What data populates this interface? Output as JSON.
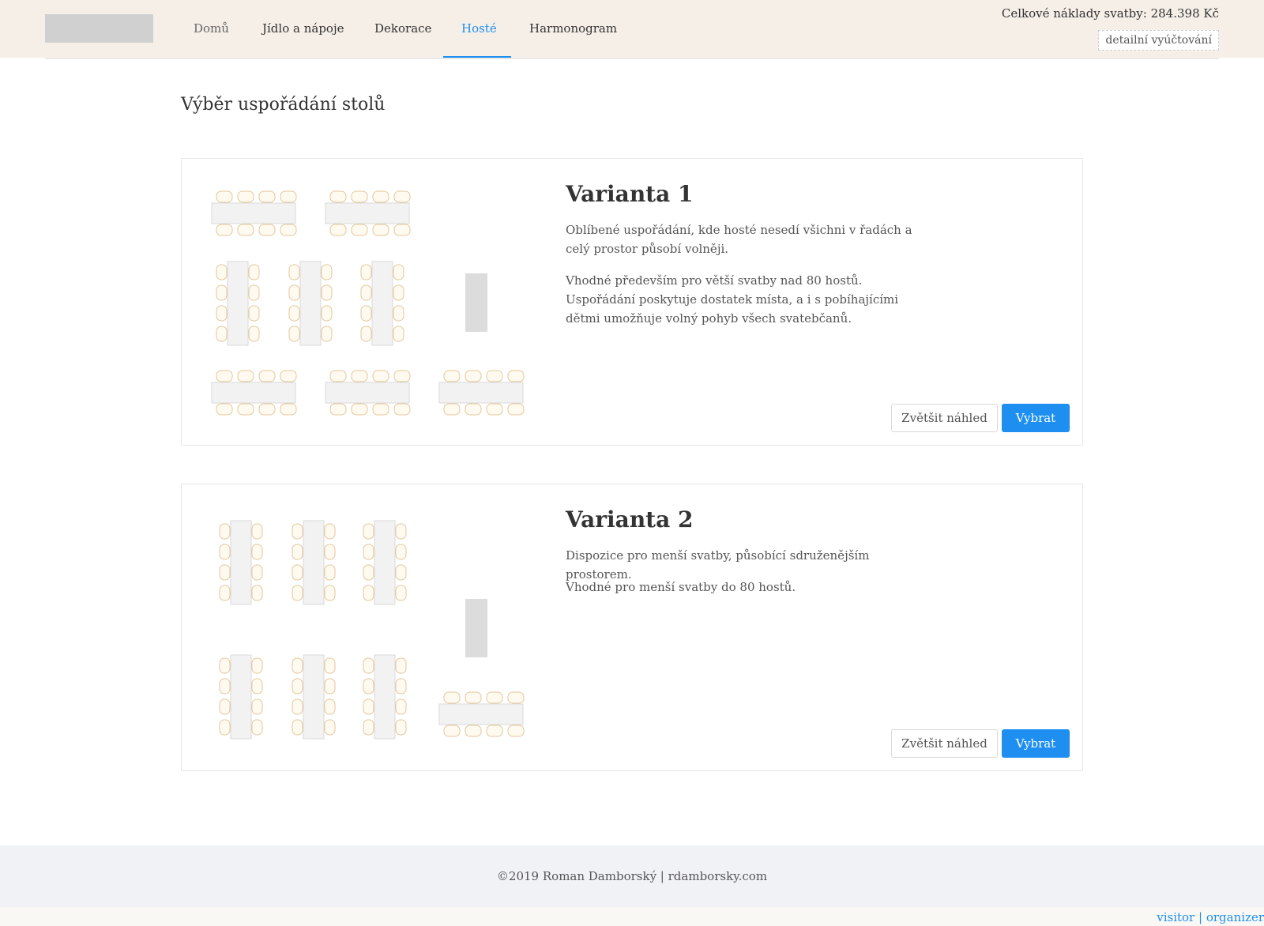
{
  "nav": {
    "items": [
      {
        "label": "Domů"
      },
      {
        "label": "Jídlo a nápoje"
      },
      {
        "label": "Dekorace"
      },
      {
        "label": "Hosté"
      },
      {
        "label": "Harmonogram"
      }
    ],
    "active": "Hosté"
  },
  "header": {
    "total_cost": "Celkové náklady svatby: 284.398 Kč",
    "detail_link": "detailní vyúčtování"
  },
  "page": {
    "title": "Výběr uspořádání stolů"
  },
  "variants": [
    {
      "title": "Varianta 1",
      "paragraphs": [
        "Oblíbené uspořádání, kde hosté nesedí všichni v řadách a celý prostor působí volněji.",
        "Vhodné především pro větší svatby nad 80 hostů. Uspořádání poskytuje dostatek místa, a i s pobíhajícími dětmi umožňuje volný pohyb všech svatebčanů."
      ],
      "zoom_label": "Zvětšit náhled",
      "select_label": "Vybrat"
    },
    {
      "title": "Varianta 2",
      "paragraphs": [
        "Dispozice pro menší svatby, působící sdruženějším prostorem.",
        "Vhodné pro menší svatby do 80 hostů."
      ],
      "zoom_label": "Zvětšit náhled",
      "select_label": "Vybrat"
    }
  ],
  "footer": {
    "copyright": "©2019 Roman Damborský | rdamborsky.com",
    "role_visitor": "visitor",
    "role_separator": "|",
    "role_organizer": "organizer"
  },
  "colors": {
    "accent": "#1e8ff0",
    "header_bg": "#f6efe8",
    "chair_stroke": "#e4c79a"
  }
}
